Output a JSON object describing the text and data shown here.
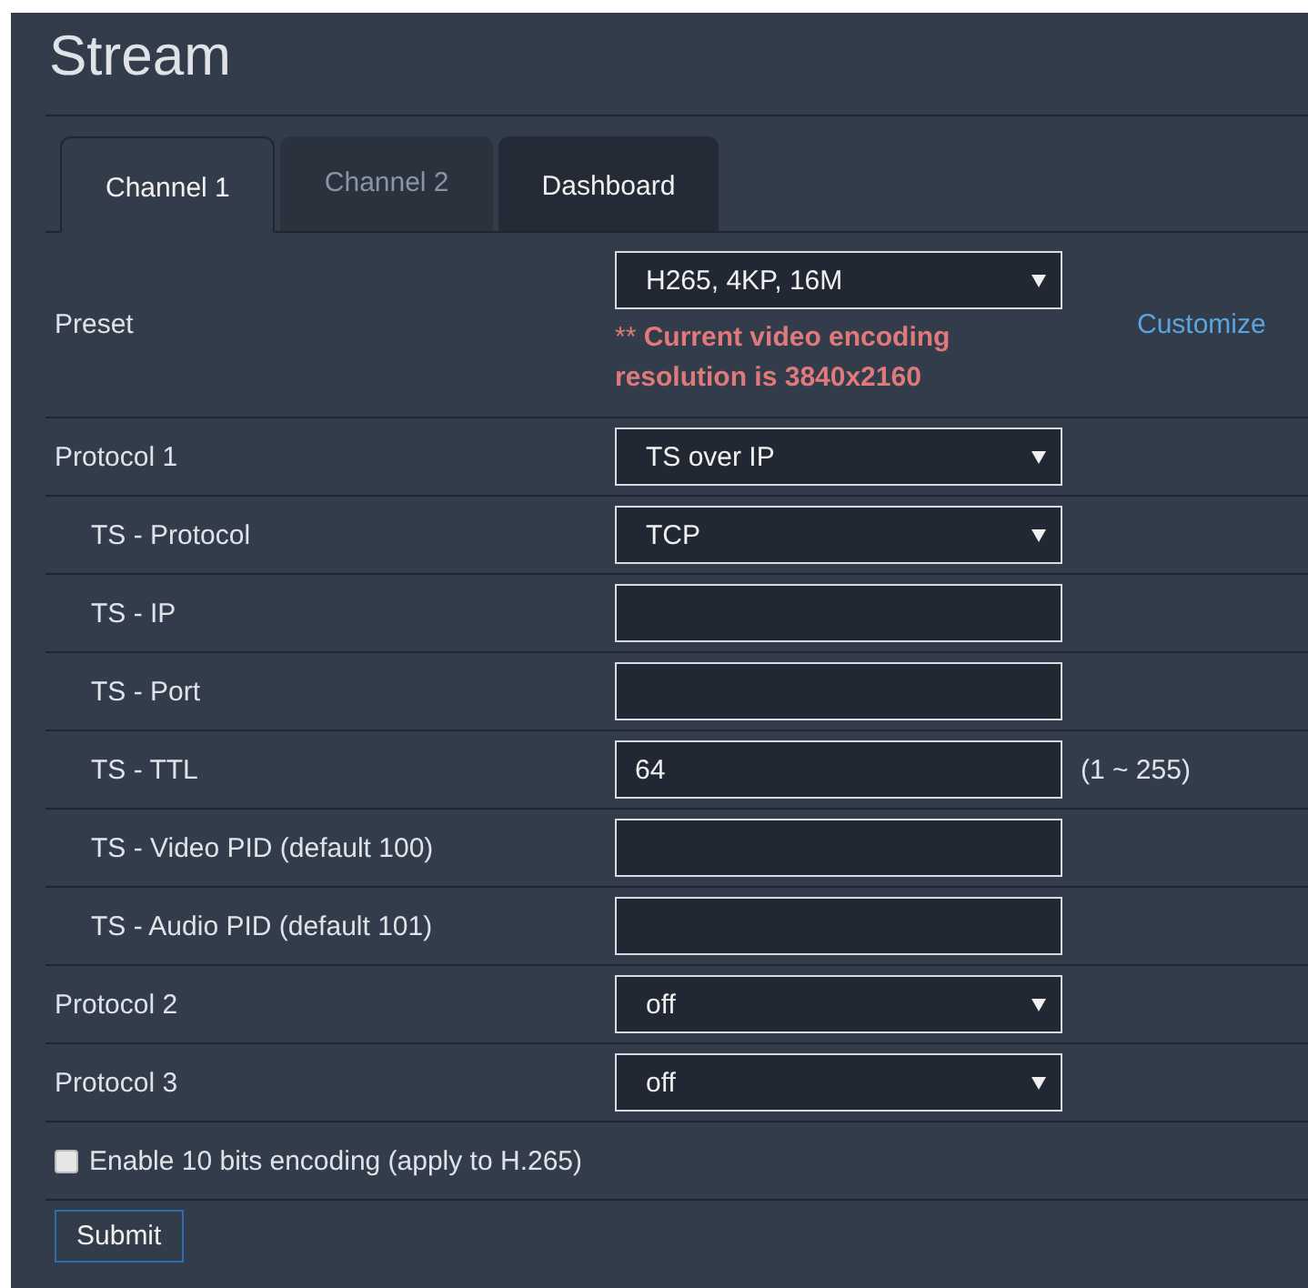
{
  "title": "Stream",
  "tabs": [
    {
      "label": "Channel 1",
      "selected": true,
      "disabled": false
    },
    {
      "label": "Channel 2",
      "selected": false,
      "disabled": true
    },
    {
      "label": "Dashboard",
      "selected": false,
      "disabled": false
    }
  ],
  "preset": {
    "label": "Preset",
    "value": "H265, 4KP, 16M",
    "note": "** **Current video encoding resolution is 3840x2160**",
    "link": "Customize"
  },
  "rows": [
    {
      "label": "Protocol 1",
      "kind": "select",
      "value": "TS over IP",
      "children": [
        {
          "label": "TS - Protocol",
          "kind": "select",
          "value": "TCP"
        },
        {
          "label": "TS - IP",
          "kind": "text"
        },
        {
          "label": "TS - Port",
          "kind": "text"
        },
        {
          "label": "TS - TTL",
          "kind": "text",
          "value": "64",
          "hint": "(1 ~ 255)"
        },
        {
          "label": "TS - Video PID (default 100)",
          "kind": "text"
        },
        {
          "label": "TS - Audio PID (default 101)",
          "kind": "text"
        }
      ]
    },
    {
      "label": "Protocol 2",
      "kind": "select",
      "value": "off"
    },
    {
      "label": "Protocol 3",
      "kind": "select",
      "value": "off"
    }
  ],
  "checkbox": {
    "label": "Enable 10 bits encoding (apply to H.265)",
    "checked": false
  },
  "submit": "Submit"
}
